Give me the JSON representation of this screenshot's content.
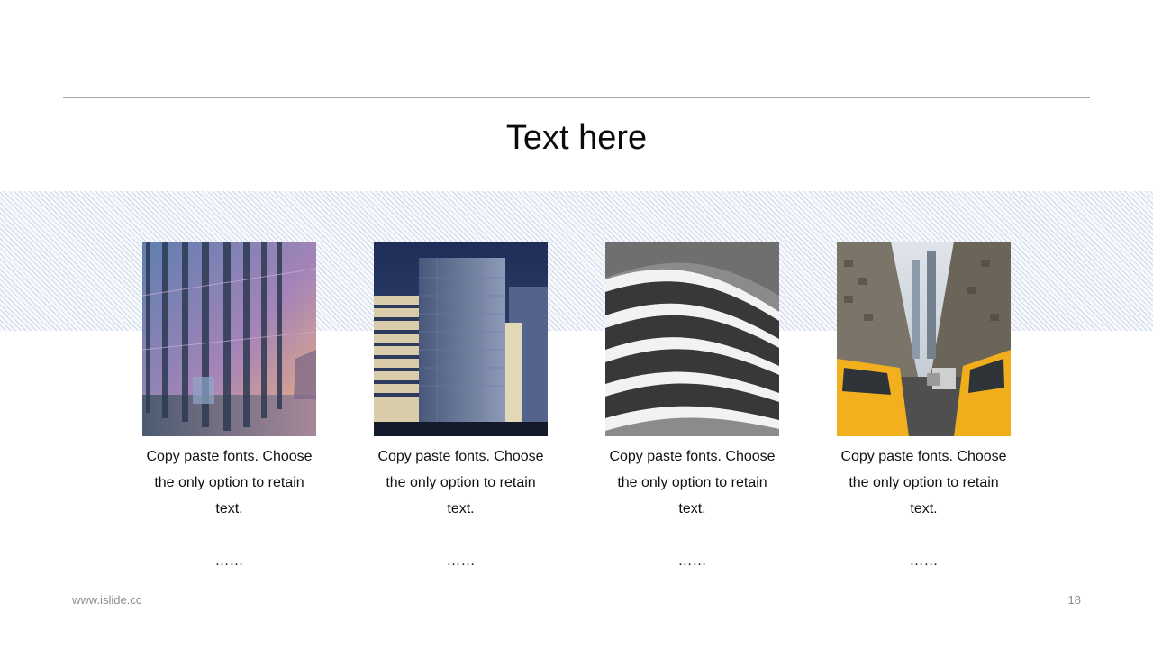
{
  "slide": {
    "title": "Text here",
    "page_number": "18"
  },
  "footer": {
    "website": "www.islide.cc"
  },
  "cards": [
    {
      "image": "glass-facade-photo",
      "caption": "Copy paste fonts. Choose the only option to retain text.",
      "more": "……"
    },
    {
      "image": "office-tower-photo",
      "caption": "Copy paste fonts. Choose the only option to retain text.",
      "more": "……"
    },
    {
      "image": "curved-building-photo",
      "caption": "Copy paste fonts. Choose the only option to retain text.",
      "more": "……"
    },
    {
      "image": "city-street-taxi-photo",
      "caption": "Copy paste fonts. Choose the only option to retain text.",
      "more": "……"
    }
  ],
  "colors": {
    "rule": "#a6a6a6",
    "band_pattern": "#aabcd6",
    "footer_text": "#8c8c8c"
  }
}
